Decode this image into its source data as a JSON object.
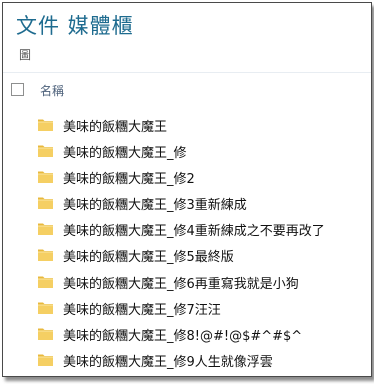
{
  "library": {
    "title": "文件 媒體櫃",
    "subtitle": "圖"
  },
  "columns": {
    "name": "名稱"
  },
  "icons": {
    "folder": "folder-icon",
    "folder_color": "#e8b83c"
  },
  "items": [
    {
      "label": "美味的飯糰大魔王"
    },
    {
      "label": "美味的飯糰大魔王_修"
    },
    {
      "label": "美味的飯糰大魔王_修2"
    },
    {
      "label": "美味的飯糰大魔王_修3重新練成"
    },
    {
      "label": "美味的飯糰大魔王_修4重新練成之不要再改了"
    },
    {
      "label": "美味的飯糰大魔王_修5最終版"
    },
    {
      "label": "美味的飯糰大魔王_修6再重寫我就是小狗"
    },
    {
      "label": "美味的飯糰大魔王_修7汪汪"
    },
    {
      "label": "美味的飯糰大魔王_修8!@#!@$#^#$^"
    },
    {
      "label": "美味的飯糰大魔王_修9人生就像浮雲"
    }
  ]
}
